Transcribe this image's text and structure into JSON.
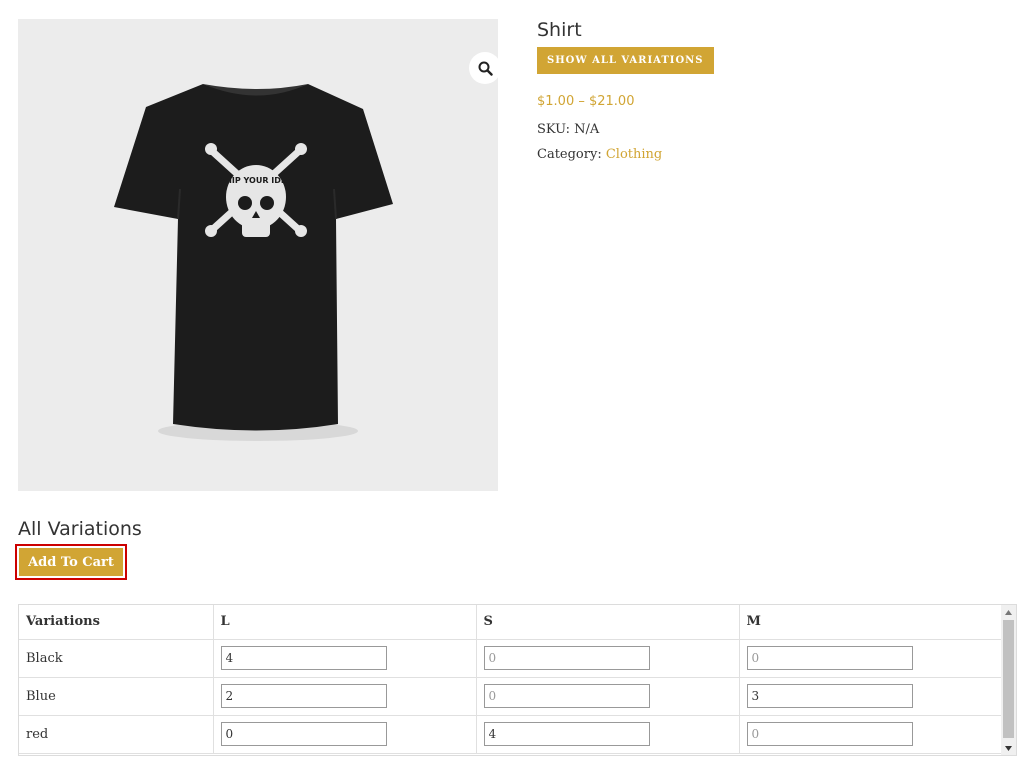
{
  "product": {
    "title": "Shirt",
    "show_variations_label": "SHOW ALL VARIATIONS",
    "price": "$1.00 – $21.00",
    "sku_label": "SKU:",
    "sku_value": "N/A",
    "category_label": "Category:",
    "category_value": "Clothing",
    "image_text": "SHIP YOUR IDEA"
  },
  "variations": {
    "heading": "All Variations",
    "add_to_cart_label": "Add To Cart",
    "columns": [
      "Variations",
      "L",
      "S",
      "M"
    ],
    "rows": [
      {
        "name": "Black",
        "L": "4",
        "S": "0",
        "M": "0"
      },
      {
        "name": "Blue",
        "L": "2",
        "S": "0",
        "M": "3"
      },
      {
        "name": "red",
        "L": "0",
        "S": "4",
        "M": "0"
      }
    ]
  },
  "icons": {
    "zoom": "search-icon",
    "scroll_up": "arrow-up-icon",
    "scroll_down": "arrow-down-icon"
  },
  "colors": {
    "accent": "#d1a534",
    "highlight_border": "#cc0000",
    "gallery_bg": "#ececec"
  }
}
